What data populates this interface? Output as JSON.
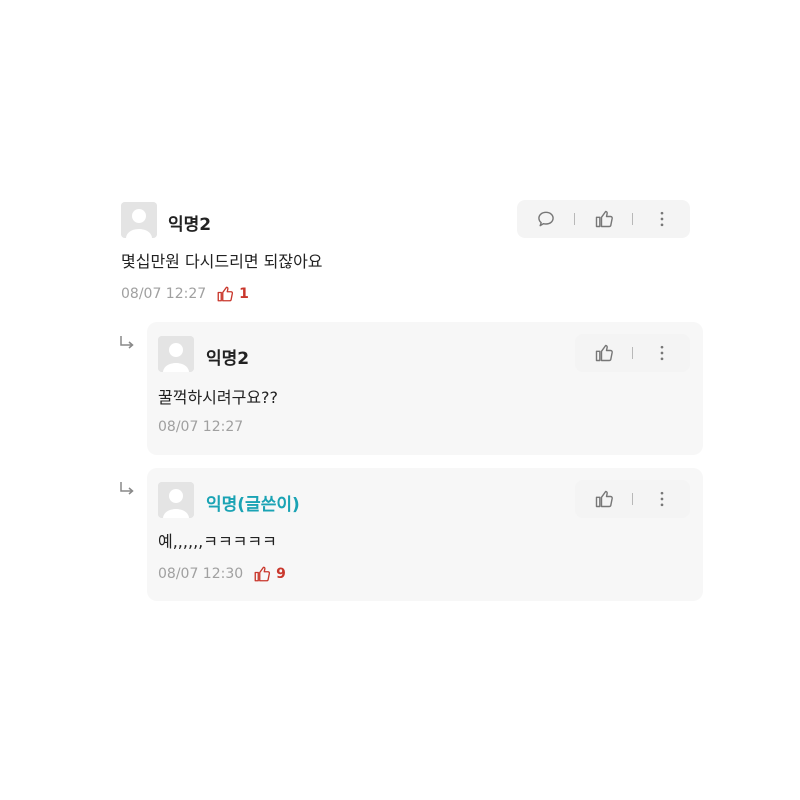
{
  "comments": [
    {
      "nickname": "익명2",
      "text": "몇십만원 다시드리면 되잖아요",
      "time": "08/07 12:27",
      "likes": "1",
      "actions": [
        "comment-icon",
        "thumbs-up-icon",
        "more-icon"
      ]
    }
  ],
  "replies": [
    {
      "nickname": "익명2",
      "text": "꿀꺽하시려구요??",
      "time": "08/07 12:27",
      "likes": "",
      "actions": [
        "thumbs-up-icon",
        "more-icon"
      ]
    },
    {
      "nickname": "익명(글쓴이)",
      "text": "예,,,,,,ㅋㅋㅋㅋㅋ",
      "time": "08/07 12:30",
      "likes": "9",
      "is_author": true,
      "actions": [
        "thumbs-up-icon",
        "more-icon"
      ]
    }
  ],
  "colors": {
    "author_nickname": "#1aa3b4",
    "like_count": "#c9372c",
    "meta_text": "#a0a0a0",
    "reply_bg": "#f7f7f7",
    "action_bg": "#f4f4f4"
  }
}
